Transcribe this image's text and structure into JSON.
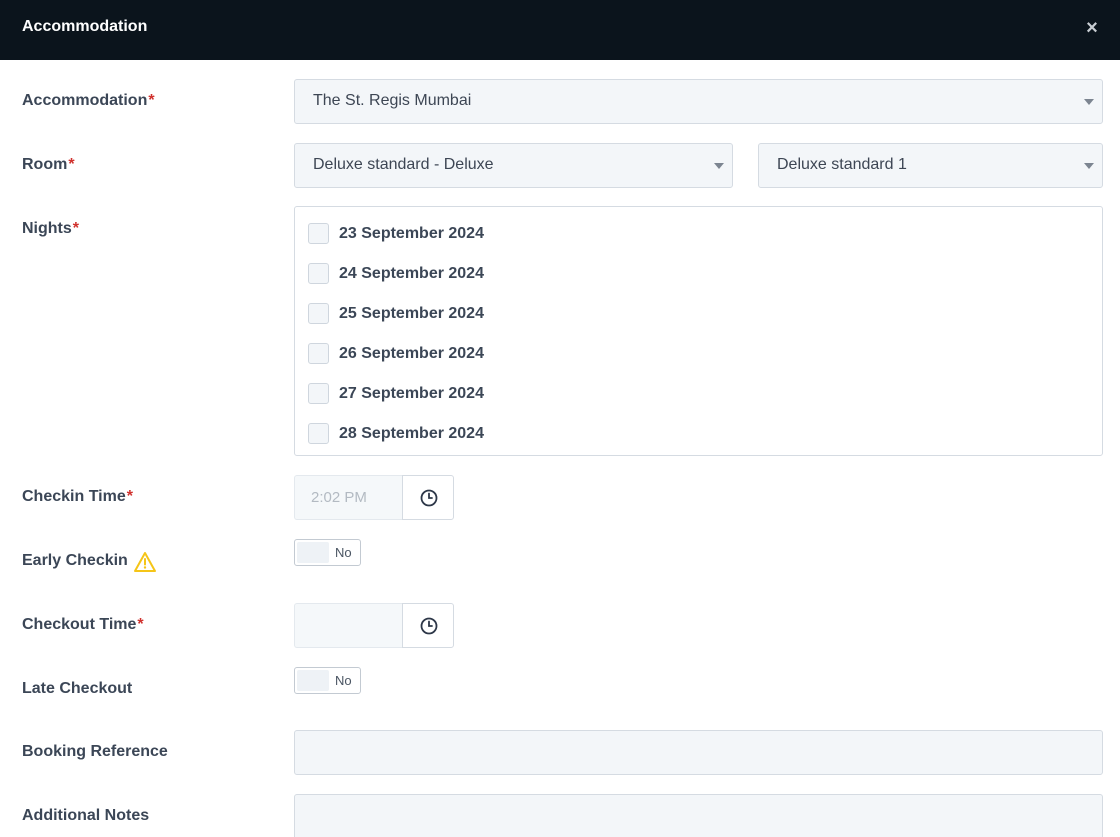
{
  "dialog": {
    "title": "Accommodation",
    "close_glyph": "×"
  },
  "required_mark": "*",
  "accommodation": {
    "label": "Accommodation",
    "value": "The St. Regis Mumbai"
  },
  "room": {
    "label": "Room",
    "type_value": "Deluxe standard - Deluxe",
    "room_value": "Deluxe standard 1"
  },
  "nights": {
    "label": "Nights",
    "items": [
      {
        "label": "23 September 2024",
        "checked": false
      },
      {
        "label": "24 September 2024",
        "checked": false
      },
      {
        "label": "25 September 2024",
        "checked": false
      },
      {
        "label": "26 September 2024",
        "checked": false
      },
      {
        "label": "27 September 2024",
        "checked": false
      },
      {
        "label": "28 September 2024",
        "checked": false
      }
    ]
  },
  "checkin_time": {
    "label": "Checkin Time",
    "placeholder": "2:02 PM",
    "value": ""
  },
  "early_checkin": {
    "label": "Early Checkin",
    "toggle_text": "No",
    "warning_icon": "warning-triangle-icon",
    "warning_color": "#f5c518"
  },
  "checkout_time": {
    "label": "Checkout Time",
    "placeholder": "",
    "value": ""
  },
  "late_checkout": {
    "label": "Late Checkout",
    "toggle_text": "No"
  },
  "booking_reference": {
    "label": "Booking Reference",
    "value": ""
  },
  "additional_notes": {
    "label": "Additional Notes",
    "value": ""
  },
  "colors": {
    "header_bg": "#0b141c",
    "required": "#d0312d",
    "field_bg": "#f3f6f9"
  }
}
